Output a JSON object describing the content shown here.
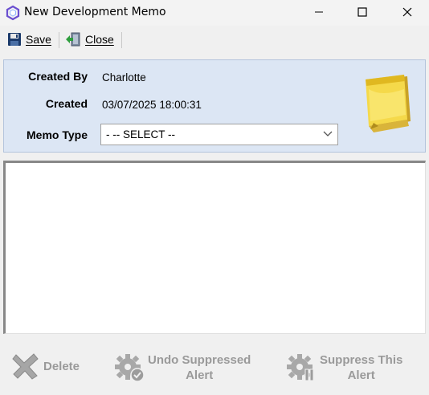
{
  "window": {
    "title": "New Development Memo"
  },
  "toolbar": {
    "save_label": "Save",
    "close_label": "Close"
  },
  "header": {
    "created_by_label": "Created By",
    "created_by_value": "Charlotte",
    "created_label": "Created",
    "created_value": "03/07/2025 18:00:31",
    "memo_type_label": "Memo Type",
    "memo_type_selected": "- -- SELECT --"
  },
  "memo_body": {
    "text": ""
  },
  "actions": {
    "delete_label": "Delete",
    "undo_line1": "Undo Suppressed",
    "undo_line2": "Alert",
    "suppress_line1": "Suppress This",
    "suppress_line2": "Alert"
  },
  "icons": {
    "app": "app-logo-icon",
    "save": "floppy-disk-icon",
    "close": "exit-door-icon",
    "note": "sticky-note-icon",
    "delete": "x-icon",
    "undo": "gear-check-icon",
    "suppress": "gear-pause-icon"
  },
  "colors": {
    "header_bg": "#dce6f4",
    "disabled_text": "#9a9a9a",
    "note_yellow": "#f5d94a"
  }
}
